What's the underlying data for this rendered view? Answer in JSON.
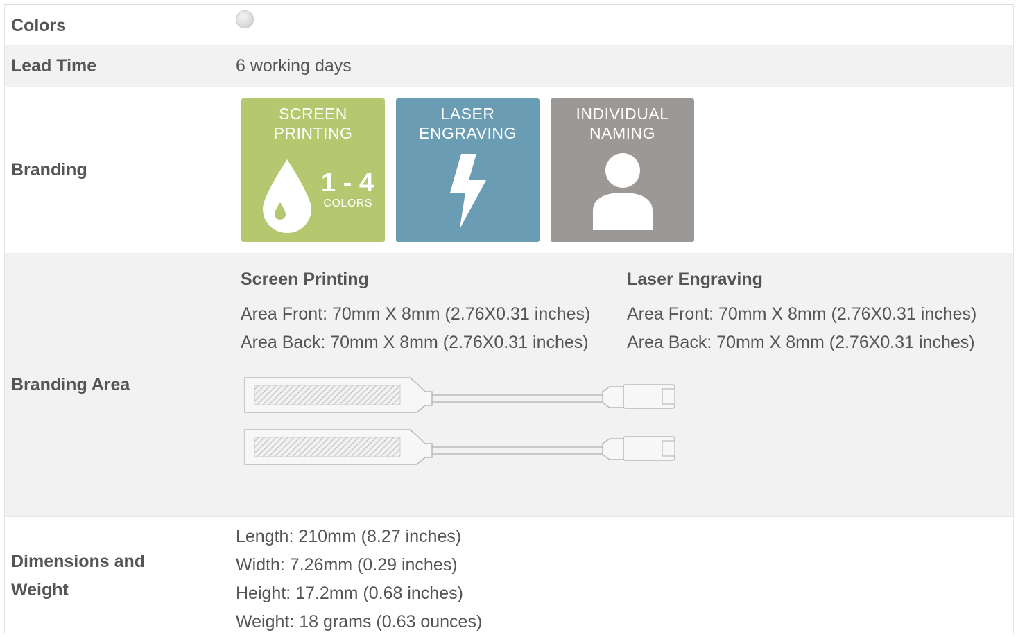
{
  "rows": {
    "colors": {
      "label": "Colors",
      "swatches": [
        "#d9d9d9"
      ]
    },
    "lead_time": {
      "label": "Lead Time",
      "value": "6 working days"
    },
    "branding": {
      "label": "Branding",
      "tiles": [
        {
          "title_line1": "SCREEN",
          "title_line2": "PRINTING",
          "count": "1 - 4",
          "count_label": "COLORS",
          "color": "#b5c870",
          "icon": "ink-drop-icon"
        },
        {
          "title_line1": "LASER",
          "title_line2": "ENGRAVING",
          "color": "#6a9cb3",
          "icon": "lightning-icon"
        },
        {
          "title_line1": "INDIVIDUAL",
          "title_line2": "NAMING",
          "color": "#9b9896",
          "icon": "person-icon"
        }
      ]
    },
    "branding_area": {
      "label": "Branding Area",
      "methods": [
        {
          "name": "Screen Printing",
          "front": "Area Front: 70mm X 8mm (2.76X0.31 inches)",
          "back": "Area Back: 70mm X 8mm (2.76X0.31 inches)"
        },
        {
          "name": "Laser Engraving",
          "front": "Area Front: 70mm X 8mm (2.76X0.31 inches)",
          "back": "Area Back: 70mm X 8mm (2.76X0.31 inches)"
        }
      ]
    },
    "dimensions": {
      "label_line1": "Dimensions and",
      "label_line2": "Weight",
      "length": "Length: 210mm (8.27 inches)",
      "width": "Width: 7.26mm (0.29 inches)",
      "height": "Height: 17.2mm (0.68 inches)",
      "weight": "Weight: 18 grams (0.63 ounces)"
    }
  }
}
